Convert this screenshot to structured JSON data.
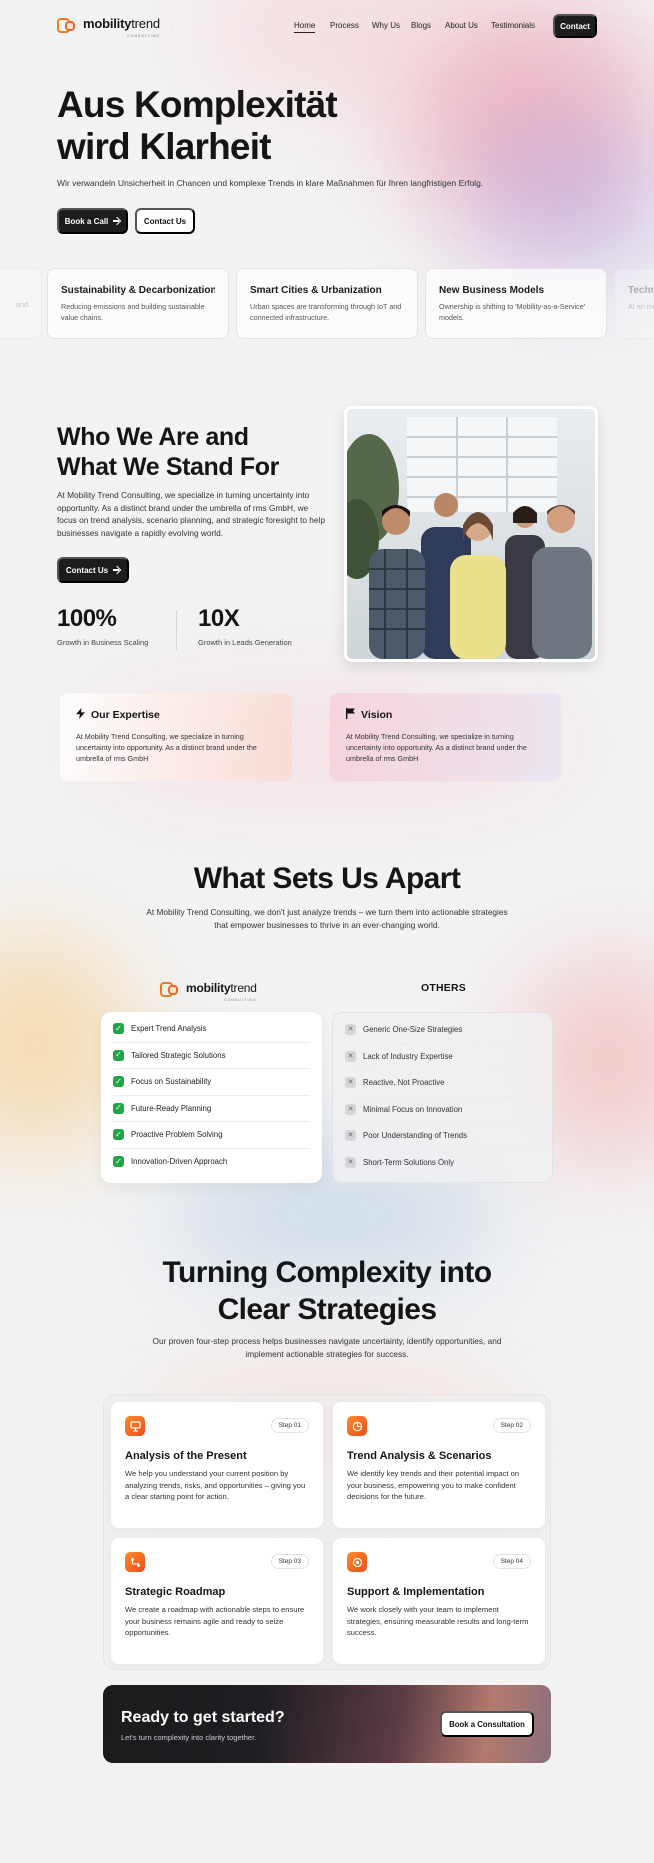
{
  "brand": {
    "name_bold": "mobility",
    "name_light": "trend",
    "tagline": "CONSULTING",
    "accent": "#f07a20"
  },
  "nav": {
    "links": [
      "Home",
      "Process",
      "Why Us",
      "Blogs",
      "About Us",
      "Testimonials"
    ],
    "active": "Home",
    "contact_label": "Contact"
  },
  "hero": {
    "title_line1": "Aus Komplexität",
    "title_line2": "wird Klarheit",
    "subtitle": "Wir verwandeln Unsicherheit in Chancen und komplexe Trends in klare Maßnahmen für Ihren langfristigen Erfolg.",
    "primary_button": "Book a Call",
    "secondary_button": "Contact Us"
  },
  "trends": [
    {
      "title": "",
      "desc": "and"
    },
    {
      "title": "Sustainability & Decarbonization",
      "desc": "Reducing emissions and building sustainable value chains."
    },
    {
      "title": "Smart Cities & Urbanization",
      "desc": "Urban spaces are transforming through IoT and connected infrastructure."
    },
    {
      "title": "New Business Models",
      "desc": "Ownership is shifting to 'Mobility-as-a-Service' models."
    },
    {
      "title": "Techn",
      "desc": "AI an mobili"
    }
  ],
  "who": {
    "title_line1": "Who We Are and",
    "title_line2": "What We Stand For",
    "text": "At Mobility Trend Consulting, we specialize in turning uncertainty into opportunity. As a distinct brand under the umbrella of rms GmbH, we focus on trend analysis, scenario planning, and strategic foresight to help businesses navigate a rapidly evolving world.",
    "button": "Contact Us",
    "stats": [
      {
        "value": "100%",
        "label": "Growth in Business Scaling"
      },
      {
        "value": "10X",
        "label": "Growth in Leads Generation"
      }
    ]
  },
  "pillars": [
    {
      "icon": "bolt-icon",
      "title": "Our Expertise",
      "text": "At Mobility Trend Consulting, we specialize in turning uncertainty into opportunity. As a distinct brand under the umbrella of rms GmbH"
    },
    {
      "icon": "flag-icon",
      "title": "Vision",
      "text": "At Mobility Trend Consulting, we specialize in turning uncertainty into opportunity. As a distinct brand under the umbrella of rms GmbH"
    }
  ],
  "apart": {
    "title": "What Sets Us Apart",
    "subtitle": "At Mobility Trend Consulting, we don't just analyze trends – we turn them into actionable strategies that empower businesses to thrive in an ever-changing world.",
    "others_label": "OTHERS",
    "us": [
      "Expert Trend Analysis",
      "Tailored Strategic Solutions",
      "Focus on Sustainability",
      "Future-Ready Planning",
      "Proactive Problem Solving",
      "Innovation-Driven Approach"
    ],
    "others": [
      "Generic One-Size Strategies",
      "Lack of Industry Expertise",
      "Reactive, Not Proactive",
      "Minimal Focus on Innovation",
      "Poor Understanding of Trends",
      "Short-Term Solutions Only"
    ],
    "check_color": "#22a447"
  },
  "process": {
    "title_line1": "Turning Complexity into",
    "title_line2": "Clear Strategies",
    "subtitle": "Our proven four-step process helps businesses navigate uncertainty, identify opportunities, and implement actionable strategies for success.",
    "steps": [
      {
        "badge": "Step 01",
        "title": "Analysis of the Present",
        "text": "We help you understand your current position by analyzing trends, risks, and opportunities – giving you a clear starting point for action.",
        "icon": "presentation-icon"
      },
      {
        "badge": "Step 02",
        "title": "Trend Analysis & Scenarios",
        "text": "We identify key trends and their potential impact on your business, empowering you to make confident decisions for the future.",
        "icon": "pie-chart-icon"
      },
      {
        "badge": "Step 03",
        "title": "Strategic Roadmap",
        "text": "We create a roadmap with actionable steps to ensure your business remains agile and ready to seize opportunities.",
        "icon": "route-icon"
      },
      {
        "badge": "Step 04",
        "title": "Support & Implementation",
        "text": "We work closely with your team to implement strategies, ensuring measurable results and long-term success.",
        "icon": "support-icon"
      }
    ]
  },
  "cta": {
    "title": "Ready to get started?",
    "subtitle": "Let's turn complexity into clarity together.",
    "button": "Book a Consultation"
  }
}
